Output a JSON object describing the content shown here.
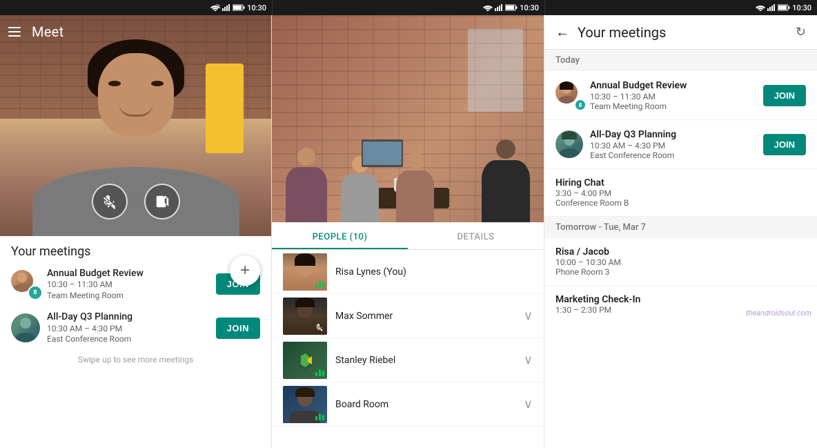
{
  "statusBar": {
    "time": "10:30",
    "icons": [
      "wifi",
      "signal",
      "battery"
    ]
  },
  "panelLeft": {
    "appTitle": "Meet",
    "controls": {
      "mute": "mic-off",
      "videoOff": "video-off"
    },
    "sectionTitle": "Your meetings",
    "meetings": [
      {
        "id": "budget",
        "title": "Annual Budget Review",
        "time": "10:30 – 11:30 AM",
        "location": "Team Meeting Room",
        "joinLabel": "JOIN"
      },
      {
        "id": "q3planning",
        "title": "All-Day Q3 Planning",
        "time": "10:30 AM – 4:30 PM",
        "location": "East Conference Room",
        "joinLabel": "JOIN"
      }
    ],
    "swipeHint": "Swipe up to see more meetings",
    "fabLabel": "+"
  },
  "panelMiddle": {
    "tabs": [
      {
        "id": "people",
        "label": "PEOPLE (10)",
        "active": true
      },
      {
        "id": "details",
        "label": "DETAILS",
        "active": false
      }
    ],
    "people": [
      {
        "name": "Risa Lynes (You)",
        "hasChevron": false,
        "micOff": false,
        "hasAudio": true
      },
      {
        "name": "Max Sommer",
        "hasChevron": true,
        "micOff": true,
        "hasAudio": false
      },
      {
        "name": "Stanley Riebel",
        "hasChevron": true,
        "micOff": false,
        "hasAudio": false
      },
      {
        "name": "Board Room",
        "hasChevron": true,
        "micOff": false,
        "hasAudio": true
      }
    ]
  },
  "panelRight": {
    "backLabel": "←",
    "title": "Your meetings",
    "refreshLabel": "↻",
    "sections": [
      {
        "label": "Today",
        "meetings": [
          {
            "id": "budget-r",
            "title": "Annual Budget Review",
            "time": "10:30 – 11:30 AM",
            "location": "Team Meeting Room",
            "joinLabel": "JOIN",
            "hasJoin": true
          },
          {
            "id": "q3-r",
            "title": "All-Day Q3 Planning",
            "time": "10:30 AM – 4:30 PM",
            "location": "East Conference Room",
            "joinLabel": "JOIN",
            "hasJoin": true
          },
          {
            "id": "hiring",
            "title": "Hiring Chat",
            "time": "3:30 – 4:00 PM",
            "location": "Conference Room B",
            "hasJoin": false
          }
        ]
      },
      {
        "label": "Tomorrow - Tue, Mar 7",
        "meetings": [
          {
            "id": "risa-jacob",
            "title": "Risa / Jacob",
            "time": "10:00 – 10:30 AM",
            "location": "Phone Room 3",
            "hasJoin": false
          },
          {
            "id": "marketing",
            "title": "Marketing Check-In",
            "time": "1:30 – 2:30 PM",
            "hasJoin": false
          }
        ]
      }
    ],
    "watermark": "theandroidsoul.com"
  }
}
